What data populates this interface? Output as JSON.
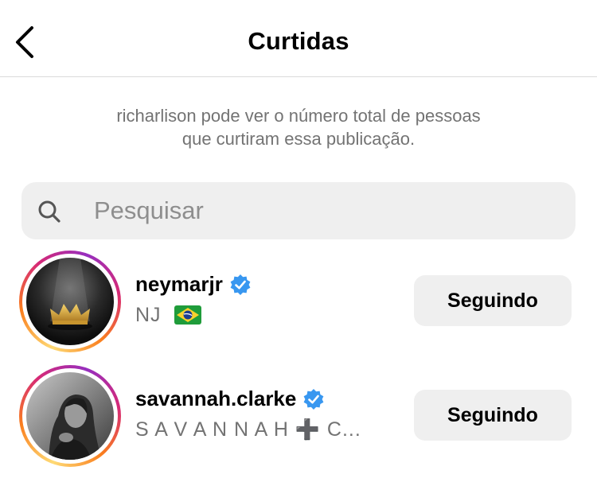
{
  "header": {
    "title": "Curtidas",
    "back_icon": "chevron-left-icon"
  },
  "notice": {
    "line1": "richarlison pode ver o número total de pessoas",
    "line2": "que curtiram essa publicação."
  },
  "search": {
    "placeholder": "Pesquisar",
    "value": "",
    "icon": "search-icon"
  },
  "users": [
    {
      "username": "neymarjr",
      "verified": true,
      "subtitle": "NJ",
      "subtitle_flag": "brazil-flag-icon",
      "button_label": "Seguindo"
    },
    {
      "username": "savannah.clarke",
      "verified": true,
      "subtitle": "S A V A N N A H ➕ C...",
      "button_label": "Seguindo"
    }
  ],
  "colors": {
    "verified_blue": "#3897f0",
    "button_bg": "#efefef",
    "secondary_text": "#737373",
    "divider": "#dbdbdb"
  }
}
